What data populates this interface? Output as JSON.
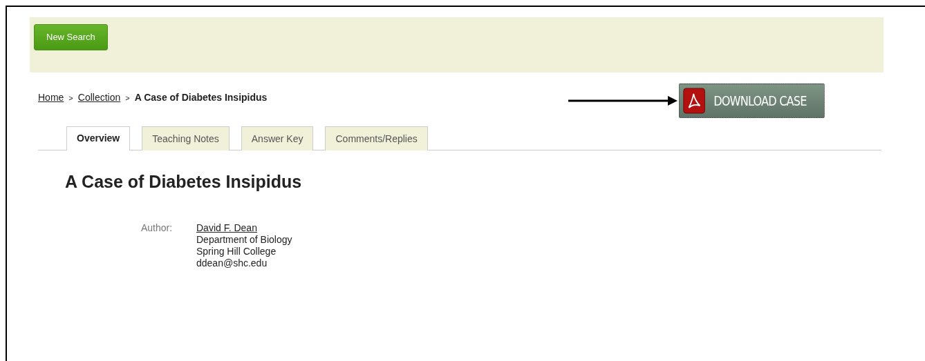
{
  "toolbar": {
    "button": "New Search"
  },
  "breadcrumb": [
    {
      "label": "Home",
      "kind": "link"
    },
    {
      "label": ">",
      "kind": "separator"
    },
    {
      "label": "Collection",
      "kind": "link"
    },
    {
      "label": ">",
      "kind": "separator"
    },
    {
      "label": "A Case of Diabetes Insipidus",
      "kind": "current"
    }
  ],
  "download": {
    "label": "DOWNLOAD CASE"
  },
  "tabs": [
    {
      "label": "Overview",
      "selected": true
    },
    {
      "label": "Teaching Notes",
      "selected": false
    },
    {
      "label": "Answer Key",
      "selected": false
    },
    {
      "label": "Comments/Replies",
      "selected": false
    }
  ],
  "title": "A Case of Diabetes Insipidus",
  "author": {
    "label": "Author:",
    "name": "David F. Dean",
    "lines": [
      "Department of Biology",
      "Spring Hill College",
      "ddean@shc.edu"
    ]
  }
}
